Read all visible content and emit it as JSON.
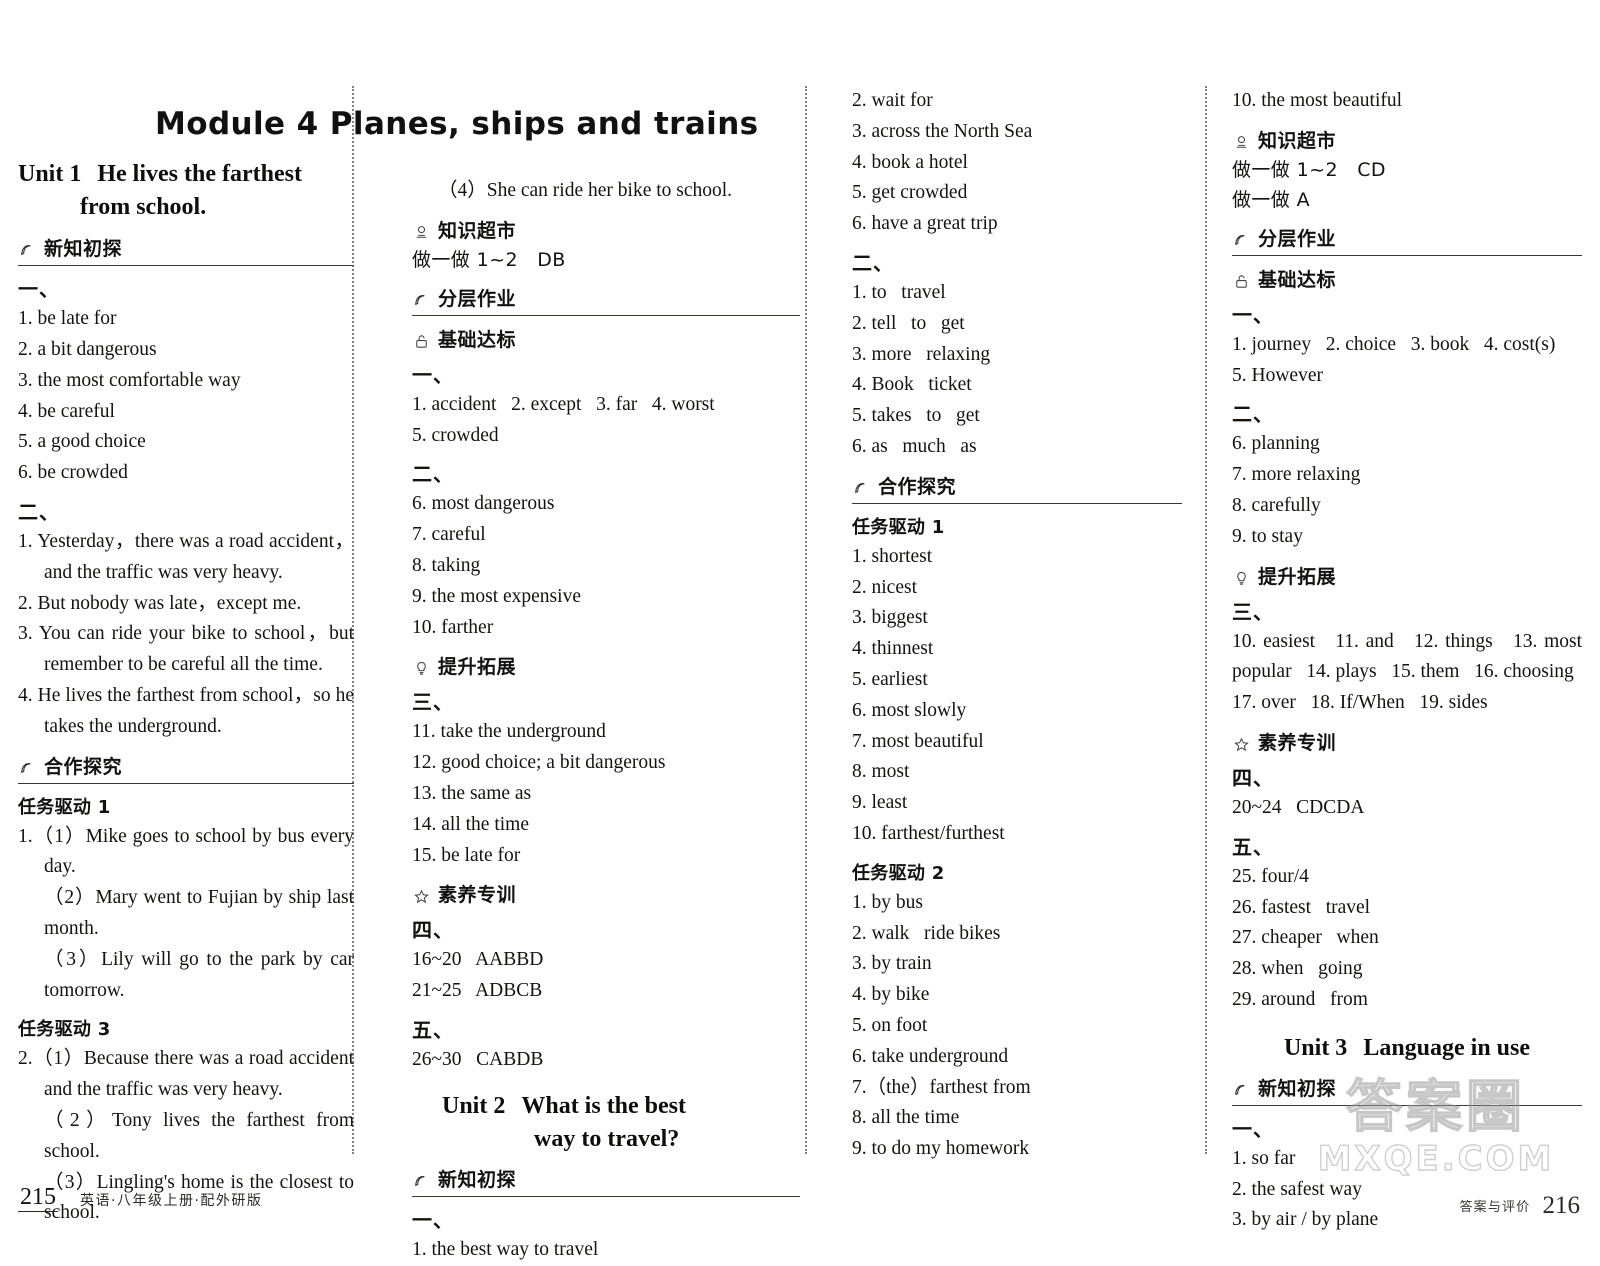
{
  "module": {
    "title": "Module 4   Planes, ships and trains"
  },
  "col1": {
    "unit": {
      "label": "Unit 1",
      "line1": "He lives the farthest",
      "line2": "from school."
    },
    "sections": [
      {
        "icon": "bookmark-icon",
        "title": "新知初探"
      }
    ],
    "s1_mark_a": "一、",
    "s1_list_a": [
      "1. be late for",
      "2. a bit dangerous",
      "3. the most comfortable way",
      "4. be careful",
      "5. a good choice",
      "6. be crowded"
    ],
    "s1_mark_b": "二、",
    "s1_list_b": [
      "1. Yesterday，there was a road accident，and the traffic was very heavy.",
      "2. But nobody was late，except me.",
      "3. You can ride your bike to school，but remember to be careful all the time.",
      "4. He lives the farthest from school，so he takes the underground."
    ],
    "sec_cooperate": {
      "icon": "bookmark-icon",
      "title": "合作探究"
    },
    "task1_title": "任务驱动 1",
    "task1_items": [
      "1.（1）Mike goes to school by bus every day.",
      "（2）Mary went to Fujian by ship last month.",
      "（3）Lily will go to the park by car tomorrow."
    ],
    "task3_title": "任务驱动 3",
    "task3_items": [
      "2.（1）Because there was a road accident and the traffic was very heavy.",
      "（2）Tony lives the farthest from school.",
      "（3）Lingling's home is the closest to school."
    ]
  },
  "col2": {
    "lead": "（4）She can ride her bike to school.",
    "sec_knowledge": {
      "icon": "stamp-icon",
      "title": "知识超市"
    },
    "knowledge_line": "做一做 1~2   DB",
    "sec_layered": {
      "icon": "bookmark-icon",
      "title": "分层作业"
    },
    "sec_basic": {
      "icon": "lock-icon",
      "title": "基础达标"
    },
    "mark_a": "一、",
    "list_a": [
      "1. accident   2. except   3. far   4. worst",
      "5. crowded"
    ],
    "mark_b": "二、",
    "list_b": [
      "6. most dangerous",
      "7. careful",
      "8. taking",
      "9. the most expensive",
      "10. farther"
    ],
    "sec_improve": {
      "icon": "bulb-icon",
      "title": "提升拓展"
    },
    "mark_c": "三、",
    "list_c": [
      "11. take the underground",
      "12. good choice; a bit dangerous",
      "13. the same as",
      "14. all the time",
      "15. be late for"
    ],
    "sec_literacy": {
      "icon": "star-icon",
      "title": "素养专训"
    },
    "mark_d": "四、",
    "list_d": [
      "16~20   AABBD",
      "21~25   ADBCB"
    ],
    "mark_e": "五、",
    "list_e": [
      "26~30   CABDB"
    ],
    "unit": {
      "label": "Unit 2",
      "line1": "What is the best",
      "line2": "way to travel?"
    },
    "sec_new": {
      "icon": "bookmark-icon",
      "title": "新知初探"
    },
    "mark_f": "一、",
    "list_f": [
      "1. the best way to travel"
    ]
  },
  "col3": {
    "list_top": [
      "2. wait for",
      "3. across the North Sea",
      "4. book a hotel",
      "5. get crowded",
      "6. have a great trip"
    ],
    "mark_b": "二、",
    "list_b": [
      "1. to   travel",
      "2. tell   to   get",
      "3. more   relaxing",
      "4. Book   ticket",
      "5. takes   to   get",
      "6. as   much   as"
    ],
    "sec_cooperate": {
      "icon": "bookmark-icon",
      "title": "合作探究"
    },
    "task1_title": "任务驱动 1",
    "task1_items": [
      "1. shortest",
      "2. nicest",
      "3. biggest",
      "4. thinnest",
      "5. earliest",
      "6. most slowly",
      "7. most beautiful",
      "8. most",
      "9. least",
      "10. farthest/furthest"
    ],
    "task2_title": "任务驱动 2",
    "task2_items": [
      "1. by bus",
      "2. walk   ride bikes",
      "3. by train",
      "4. by bike",
      "5. on foot",
      "6. take underground",
      "7.（the）farthest from",
      "8. all the time",
      "9. to do my homework"
    ]
  },
  "col4": {
    "lead": "10. the most beautiful",
    "sec_knowledge": {
      "icon": "stamp-icon",
      "title": "知识超市"
    },
    "knowledge_lines": [
      "做一做 1~2   CD",
      "做一做 A"
    ],
    "sec_layered": {
      "icon": "bookmark-icon",
      "title": "分层作业"
    },
    "sec_basic": {
      "icon": "lock-icon",
      "title": "基础达标"
    },
    "mark_a": "一、",
    "list_a": [
      "1. journey   2. choice   3. book   4. cost(s)",
      "5. However"
    ],
    "mark_b": "二、",
    "list_b": [
      "6. planning",
      "7. more relaxing",
      "8. carefully",
      "9. to stay"
    ],
    "sec_improve": {
      "icon": "bulb-icon",
      "title": "提升拓展"
    },
    "mark_c": "三、",
    "list_c": [
      "10. easiest   11. and   12. things   13. most popular   14. plays   15. them   16. choosing",
      "17. over   18. If/When   19. sides"
    ],
    "sec_literacy": {
      "icon": "star-icon",
      "title": "素养专训"
    },
    "mark_d": "四、",
    "list_d": [
      "20~24   CDCDA"
    ],
    "mark_e": "五、",
    "list_e": [
      "25. four/4",
      "26. fastest   travel",
      "27. cheaper   when",
      "28. when   going",
      "29. around   from"
    ],
    "unit": {
      "label": "Unit 3",
      "line1": "Language in use"
    },
    "sec_new": {
      "icon": "bookmark-icon",
      "title": "新知初探"
    },
    "mark_f": "一、",
    "list_f": [
      "1. so far",
      "2. the safest way",
      "3. by air / by plane"
    ]
  },
  "footer": {
    "left_page": "215",
    "left_meta": "英语·八年级上册·配外研版",
    "right_meta": "答案与评价",
    "right_page": "216"
  },
  "watermark": {
    "top": "答案圈",
    "bottom": "MXQE.COM"
  }
}
